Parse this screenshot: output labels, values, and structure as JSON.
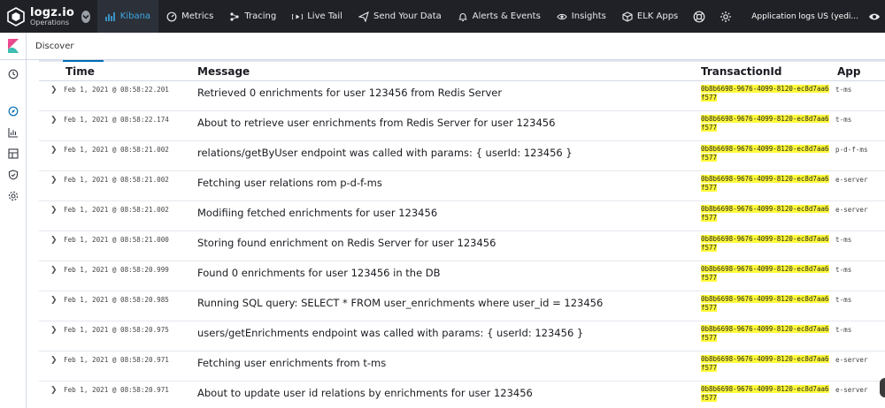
{
  "brand": {
    "name": "logz.io",
    "subtitle": "Operations"
  },
  "nav": {
    "items": [
      {
        "label": "Kibana",
        "icon": "bar-chart-icon",
        "active": true
      },
      {
        "label": "Metrics",
        "icon": "dashboard-gauge-icon",
        "active": false
      },
      {
        "label": "Tracing",
        "icon": "tracing-dots-icon",
        "active": false
      },
      {
        "label": "Live Tail",
        "icon": "live-tail-icon",
        "active": false
      },
      {
        "label": "Send Your Data",
        "icon": "send-plane-icon",
        "active": false
      },
      {
        "label": "Alerts & Events",
        "icon": "alert-bell-icon",
        "active": false
      },
      {
        "label": "Insights",
        "icon": "insights-eye-icon",
        "active": false
      },
      {
        "label": "ELK Apps",
        "icon": "apps-box-icon",
        "active": false
      }
    ],
    "account_label": "Application logs US (yedi..."
  },
  "kibana": {
    "breadcrumb": "Discover"
  },
  "table": {
    "columns": {
      "time": "Time",
      "message": "Message",
      "transaction": "TransactionId",
      "app": "App"
    },
    "rows": [
      {
        "time": "Feb 1, 2021 @ 08:58:22.201",
        "message": "Retrieved 0 enrichments for user 123456 from Redis Server",
        "tx1": "0b8b6698-9676-4099-8120-ec8d7aa6",
        "tx2": "f577",
        "app": "t-ms"
      },
      {
        "time": "Feb 1, 2021 @ 08:58:22.174",
        "message": "About to retrieve user enrichments from Redis Server for user 123456",
        "tx1": "0b8b6698-9676-4099-8120-ec8d7aa6",
        "tx2": "f577",
        "app": "t-ms"
      },
      {
        "time": "Feb 1, 2021 @ 08:58:21.002",
        "message": "relations/getByUser endpoint was called with params: { userId: 123456 }",
        "tx1": "0b8b6698-9676-4099-8120-ec8d7aa6",
        "tx2": "f577",
        "app": "p-d-f-ms"
      },
      {
        "time": "Feb 1, 2021 @ 08:58:21.002",
        "message": "Fetching user relations rom p-d-f-ms",
        "tx1": "0b8b6698-9676-4099-8120-ec8d7aa6",
        "tx2": "f577",
        "app": "e-server"
      },
      {
        "time": "Feb 1, 2021 @ 08:58:21.002",
        "message": "Modifiing fetched enrichments for user 123456",
        "tx1": "0b8b6698-9676-4099-8120-ec8d7aa6",
        "tx2": "f577",
        "app": "e-server"
      },
      {
        "time": "Feb 1, 2021 @ 08:58:21.000",
        "message": "Storing found enrichment on Redis Server for user 123456",
        "tx1": "0b8b6698-9676-4099-8120-ec8d7aa6",
        "tx2": "f577",
        "app": "t-ms"
      },
      {
        "time": "Feb 1, 2021 @ 08:58:20.999",
        "message": "Found 0 enrichments for user 123456 in the DB",
        "tx1": "0b8b6698-9676-4099-8120-ec8d7aa6",
        "tx2": "f577",
        "app": "t-ms"
      },
      {
        "time": "Feb 1, 2021 @ 08:58:20.985",
        "message": "Running SQL query: SELECT * FROM user_enrichments where user_id = 123456",
        "tx1": "0b8b6698-9676-4099-8120-ec8d7aa6",
        "tx2": "f577",
        "app": "t-ms"
      },
      {
        "time": "Feb 1, 2021 @ 08:58:20.975",
        "message": "users/getEnrichments endpoint was called with params: { userId: 123456 }",
        "tx1": "0b8b6698-9676-4099-8120-ec8d7aa6",
        "tx2": "f577",
        "app": "t-ms"
      },
      {
        "time": "Feb 1, 2021 @ 08:58:20.971",
        "message": "Fetching user enrichments from t-ms",
        "tx1": "0b8b6698-9676-4099-8120-ec8d7aa6",
        "tx2": "f577",
        "app": "e-server"
      },
      {
        "time": "Feb 1, 2021 @ 08:58:20.971",
        "message": "About to update user id relations by enrichments for user 123456",
        "tx1": "0b8b6698-9676-4099-8120-ec8d7aa6",
        "tx2": "f577",
        "app": "e-server"
      }
    ]
  },
  "colors": {
    "nav_bg": "#1f2126",
    "active_accent": "#3ea8e5",
    "highlight": "#fffa3a"
  }
}
